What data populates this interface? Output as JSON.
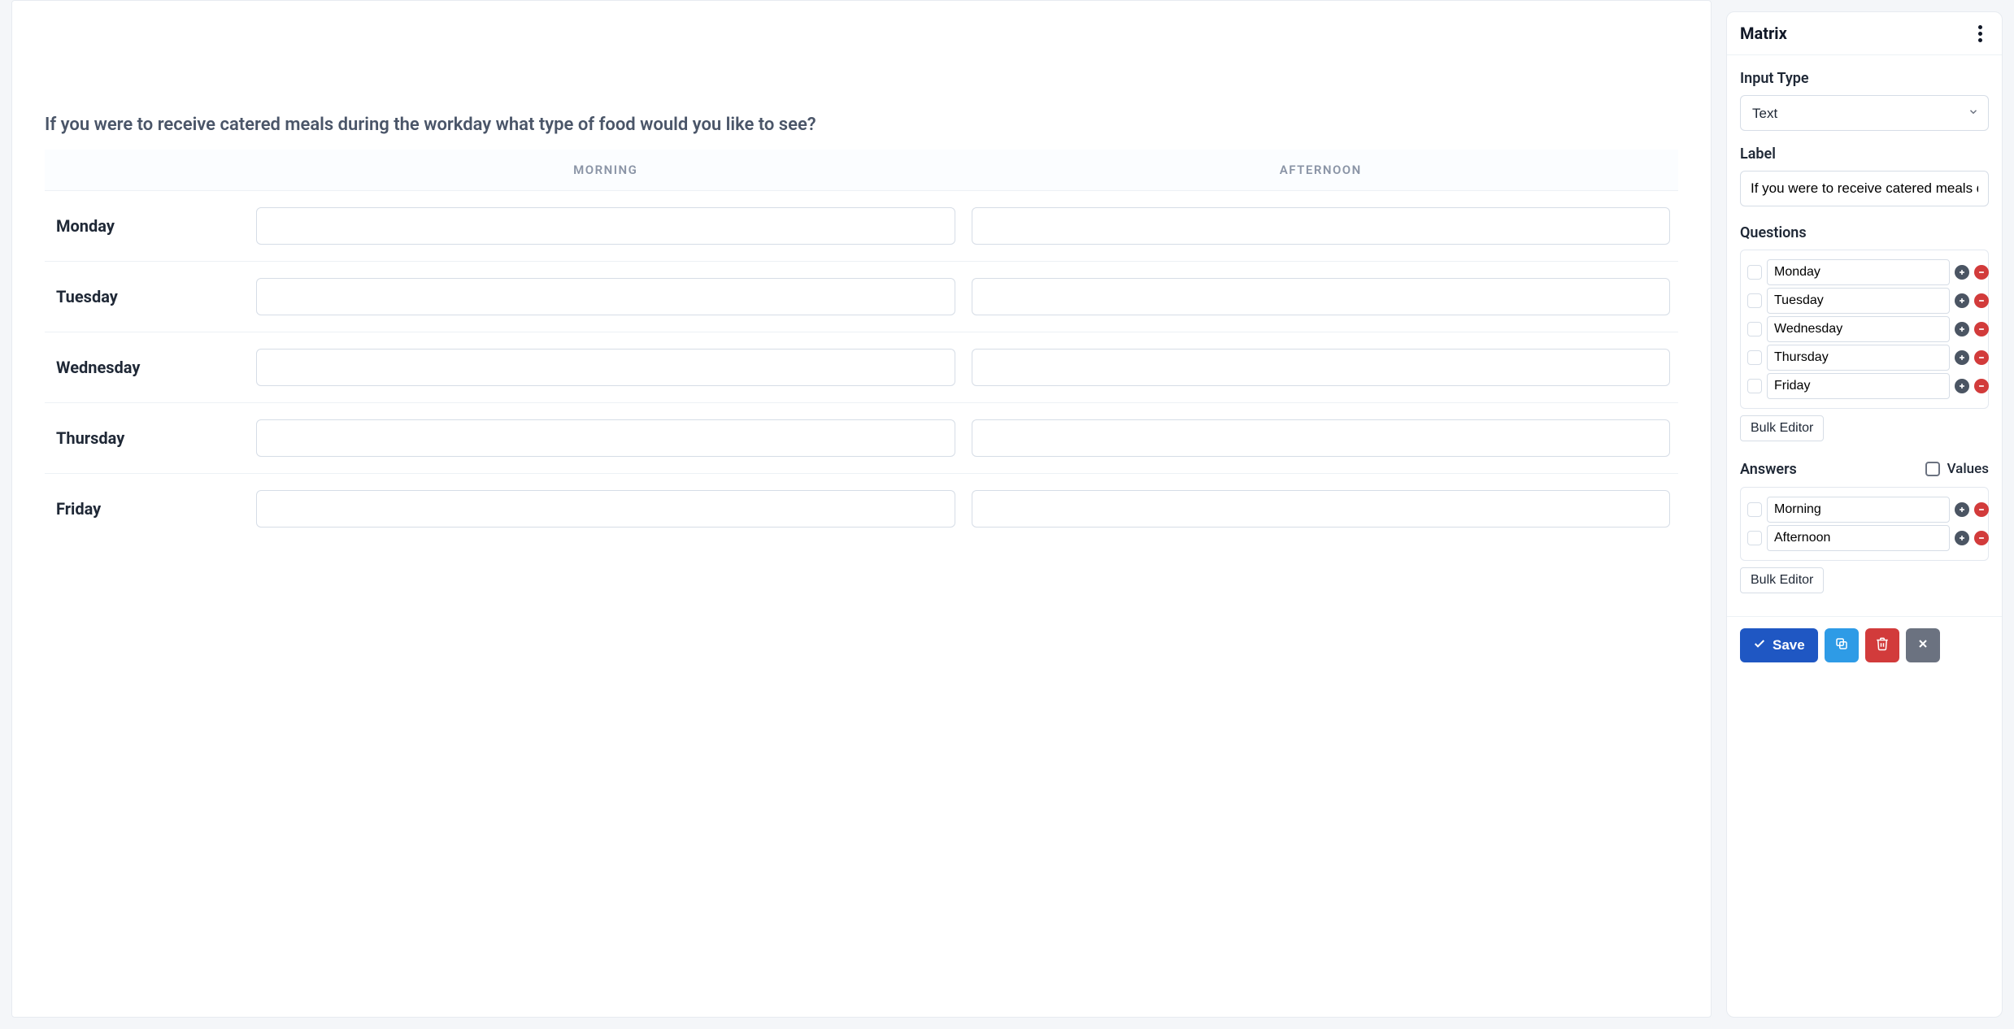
{
  "question_label": "If you were to receive catered meals during the workday what type of food would you like to see?",
  "matrix": {
    "columns": [
      "Morning",
      "Afternoon"
    ],
    "rows": [
      "Monday",
      "Tuesday",
      "Wednesday",
      "Thursday",
      "Friday"
    ]
  },
  "panel": {
    "title": "Matrix",
    "input_type_label": "Input Type",
    "input_type_value": "Text",
    "label_label": "Label",
    "label_value": "If you were to receive catered meals during the workday what type of food would you like to see?",
    "questions_label": "Questions",
    "questions": [
      "Monday",
      "Tuesday",
      "Wednesday",
      "Thursday",
      "Friday"
    ],
    "bulk_editor_label": "Bulk Editor",
    "answers_label": "Answers",
    "values_label": "Values",
    "answers": [
      "Morning",
      "Afternoon"
    ],
    "save_label": "Save"
  }
}
